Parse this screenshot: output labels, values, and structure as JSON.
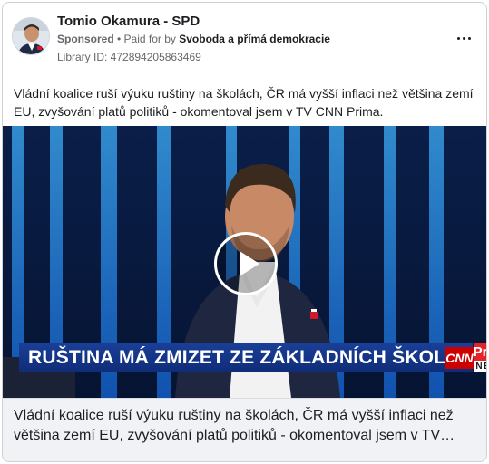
{
  "ad": {
    "page_name": "Tomio Okamura - SPD",
    "sponsored_label": "Sponsored",
    "separator": " • ",
    "paid_for_prefix": "Paid for by ",
    "payer": "Svoboda a přímá demokracie",
    "library_id": "Library ID: 472894205863469",
    "more_icon": "more-horizontal-icon",
    "body_text": "Vládní koalice ruší výuku ruštiny na školách, ČR má vyšší inflaci než většina zemí EU, zvyšování platů politiků - okomentoval jsem v TV CNN Prima."
  },
  "video": {
    "headline": "RUŠTINA MÁ ZMIZET ZE ZÁKLADNÍCH ŠKOL",
    "logo_cnn": "CNN",
    "logo_prima": "Prima",
    "logo_news": "NEWS",
    "play_icon": "play-icon"
  },
  "caption": {
    "text": "Vládní koalice ruší výuku ruštiny na školách, ČR má vyšší inflaci než většina zemí EU, zvyšování platů politiků - okomentoval jsem v TV…"
  },
  "colors": {
    "lower_third": "#1a3f98",
    "cnn_red": "#cc0000",
    "prima_red": "#e3242b",
    "studio_blue": "#1e8fff"
  }
}
